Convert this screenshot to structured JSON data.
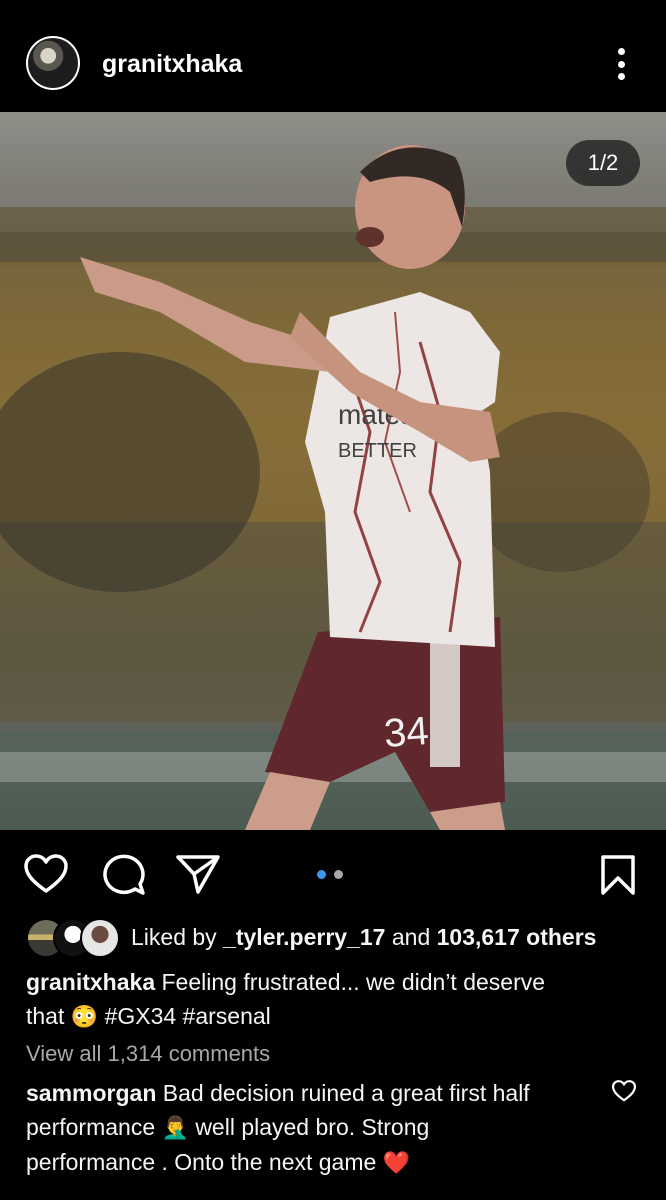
{
  "header": {
    "username": "granitxhaka",
    "more_icon": "more-vertical-icon"
  },
  "post": {
    "photo_counter": "1/2",
    "photo_description_icon": "player-photo",
    "carousel": {
      "total": 2,
      "active_index": 0,
      "active_color": "#3897f0",
      "inactive_color": "#a8a8a8"
    }
  },
  "actions": {
    "like_icon": "heart-icon",
    "comment_icon": "comment-icon",
    "share_icon": "send-icon",
    "save_icon": "bookmark-icon"
  },
  "likes": {
    "prefix": "Liked by",
    "user": "_tyler.perry_17",
    "connector": "and",
    "count": "103,617 others"
  },
  "caption": {
    "username": "granitxhaka",
    "text_1": "Feeling frustrated... we didn’t deserve",
    "text_2_start": "that",
    "emoji": "😳",
    "hashtags": "#GX34 #arsenal"
  },
  "comments": {
    "view_all": "View all 1,314 comments",
    "first": {
      "username": "sammorgan",
      "line_1": "Bad decision ruined a great first half",
      "line_2_start": "performance",
      "emoji_1": "🤦‍♂️",
      "line_2_end": "well played bro. Strong",
      "line_3": "performance . Onto the next game",
      "emoji_2": "❤️"
    }
  },
  "colors": {
    "background": "#000000",
    "text": "#f5f5f5",
    "muted": "#a8a8a8"
  }
}
